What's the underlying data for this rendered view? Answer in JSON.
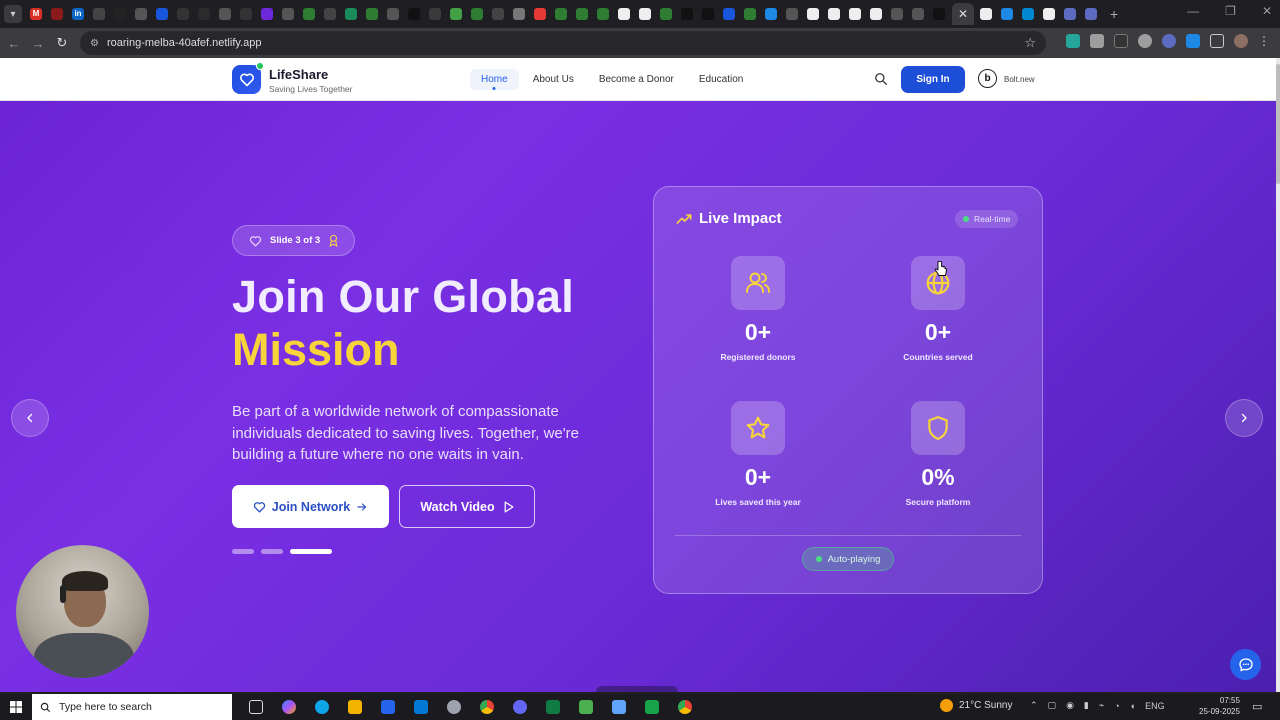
{
  "browser": {
    "url": "roaring-melba-40afef.netlify.app",
    "new_tab_glyph": "+",
    "active_tab_close": "✕"
  },
  "site": {
    "brand": "LifeShare",
    "tagline": "Saving Lives Together",
    "nav": [
      "Home",
      "About Us",
      "Become a Donor",
      "Education"
    ],
    "active_nav": "Home",
    "sign_in": "Sign In",
    "badge_letter": "b",
    "badge_text": "Bolt.new"
  },
  "hero": {
    "slide_indicator": "Slide 3 of 3",
    "headline_line1": "Join Our Global",
    "headline_line2": "Mission",
    "description": "Be part of a worldwide network of compassionate individuals dedicated to saving lives. Together, we're building a future where no one waits in vain.",
    "primary_button": "Join Network",
    "secondary_button": "Watch Video",
    "slide_count": 3,
    "active_slide": 3
  },
  "impact": {
    "title": "Live Impact",
    "status": "Real-time",
    "stats": [
      {
        "value": "0+",
        "label": "Registered donors",
        "icon": "users-icon"
      },
      {
        "value": "0+",
        "label": "Countries served",
        "icon": "globe-icon"
      },
      {
        "value": "0+",
        "label": "Lives saved this year",
        "icon": "star-icon"
      },
      {
        "value": "0%",
        "label": "Secure platform",
        "icon": "shield-icon"
      }
    ],
    "autoplay_label": "Auto-playing"
  },
  "taskbar": {
    "search_placeholder": "Type here to search",
    "weather": "21°C  Sunny",
    "language": "ENG",
    "time": "07:55",
    "date": "25-09-2025"
  },
  "colors": {
    "brand_blue": "#1d4ed8",
    "hero_purple": "#6a23d4",
    "accent_yellow": "#f7d43a",
    "live_green": "#4ade80"
  }
}
